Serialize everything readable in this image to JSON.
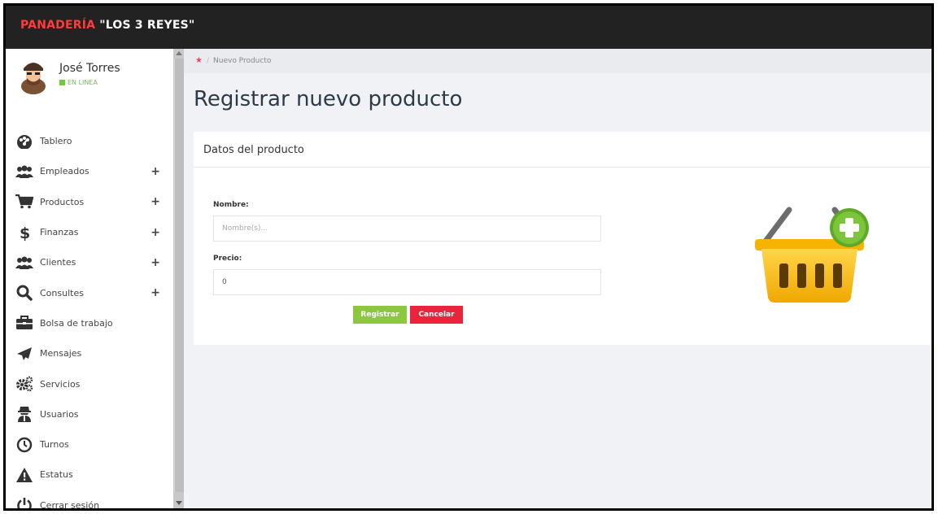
{
  "brand": {
    "part1": "PANADERÍA ",
    "part2": "\"LOS 3 REYES\""
  },
  "user": {
    "name": "José Torres",
    "status": "EN LINEA"
  },
  "menu": [
    {
      "label": "Tablero",
      "icon": "dashboard-icon",
      "expandable": false
    },
    {
      "label": "Empleados",
      "icon": "users-icon",
      "expandable": true
    },
    {
      "label": "Productos",
      "icon": "cart-icon",
      "expandable": true
    },
    {
      "label": "Finanzas",
      "icon": "dollar-icon",
      "expandable": true
    },
    {
      "label": "Clientes",
      "icon": "users-icon",
      "expandable": true
    },
    {
      "label": "Consultes",
      "icon": "search-icon",
      "expandable": true
    },
    {
      "label": "Bolsa de trabajo",
      "icon": "briefcase-icon",
      "expandable": false
    },
    {
      "label": "Mensajes",
      "icon": "paper-plane-icon",
      "expandable": false
    },
    {
      "label": "Servicios",
      "icon": "gears-icon",
      "expandable": false
    },
    {
      "label": "Usuarios",
      "icon": "user-secret-icon",
      "expandable": false
    },
    {
      "label": "Turnos",
      "icon": "clock-icon",
      "expandable": false
    },
    {
      "label": "Estatus",
      "icon": "warning-icon",
      "expandable": false
    },
    {
      "label": "Cerrar sesión",
      "icon": "power-icon",
      "expandable": false
    }
  ],
  "menu_plus": "+",
  "breadcrumb": {
    "home_icon": "home-icon",
    "current": "Nuevo Producto"
  },
  "page_title": "Registrar nuevo producto",
  "card": {
    "title": "Datos del producto",
    "name_label": "Nombre:",
    "name_placeholder": "Nombre(s)...",
    "price_label": "Precio:",
    "price_value": "0",
    "submit_label": "Registrar",
    "cancel_label": "Cancelar"
  },
  "colors": {
    "brand_red": "#ff3b3b",
    "submit_green": "#8dc63f",
    "cancel_red": "#e8253c",
    "online_green": "#6ccc3c"
  }
}
